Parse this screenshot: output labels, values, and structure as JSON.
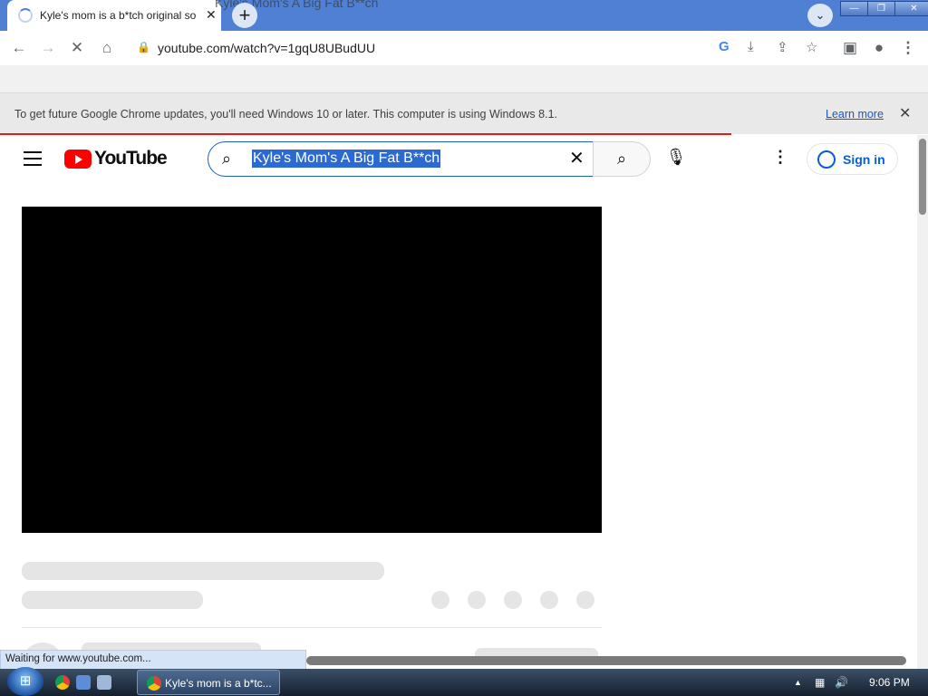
{
  "browser": {
    "tab_title": "Kyle's mom is a b*tch original so",
    "tab_close": "✕",
    "new_tab": "+",
    "ghost_drag_title": "Kyle's Mom's A Big Fat B**ch",
    "url": "youtube.com/watch?v=1gqU8UBudUU",
    "window_buttons": [
      "—",
      "❐",
      "✕"
    ]
  },
  "infobar": {
    "message": "To get future Google Chrome updates, you'll need Windows 10 or later. This computer is using Windows 8.1.",
    "link": "Learn more",
    "close": "✕"
  },
  "youtube": {
    "logo_text": "YouTube",
    "search_query": "Kyle's Mom's A Big Fat B**ch",
    "sign_in": "Sign in"
  },
  "status_text": "Waiting for www.youtube.com...",
  "taskbar": {
    "task_label": "Kyle's mom is a b*tc...",
    "clock": "9:06 PM"
  },
  "colors": {
    "titlebar": "#4f80d4",
    "youtube_red": "#ff0000",
    "link_blue": "#065fd4",
    "selection": "#2a6ad2"
  }
}
